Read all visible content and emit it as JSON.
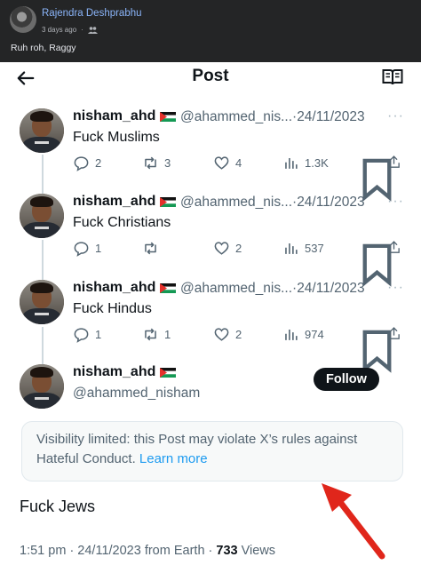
{
  "facebook_post": {
    "author": "Rajendra Deshprabhu",
    "time_ago": "3 days ago",
    "audience_icon": "friends-icon",
    "caption": "Ruh roh, Raggy"
  },
  "x_post_screen": {
    "header": {
      "title": "Post",
      "back_icon": "back-arrow-icon",
      "reader_icon": "reader-mode-icon"
    },
    "thread": [
      {
        "name": "nisham_ahd",
        "handle": "@ahammed_nis...",
        "date": "24/11/2023",
        "separator": "·",
        "text": "Fuck Muslims",
        "replies": "2",
        "reposts": "3",
        "likes": "4",
        "views": "1.3K"
      },
      {
        "name": "nisham_ahd",
        "handle": "@ahammed_nis...",
        "date": "24/11/2023",
        "separator": "·",
        "text": "Fuck Christians",
        "replies": "1",
        "reposts": "",
        "likes": "2",
        "views": "537"
      },
      {
        "name": "nisham_ahd",
        "handle": "@ahammed_nis...",
        "date": "24/11/2023",
        "separator": "·",
        "text": "Fuck Hindus",
        "replies": "1",
        "reposts": "1",
        "likes": "2",
        "views": "974"
      }
    ],
    "main_post": {
      "name": "nisham_ahd",
      "handle": "@ahammed_nisham",
      "follow_label": "Follow",
      "visibility_notice": "Visibility limited: this Post may violate X’s rules against Hateful Conduct.",
      "learn_more": "Learn more",
      "text": "Fuck Jews",
      "time": "1:51 pm",
      "date": "24/11/2023",
      "source": "from Earth",
      "views_count": "733",
      "views_label": "Views"
    },
    "more_icon": "more-dots-icon",
    "colors": {
      "accent_link": "#1d9bf0",
      "text_primary": "#0f1419",
      "text_secondary": "#536471",
      "annotation_arrow": "#e0261b"
    }
  }
}
